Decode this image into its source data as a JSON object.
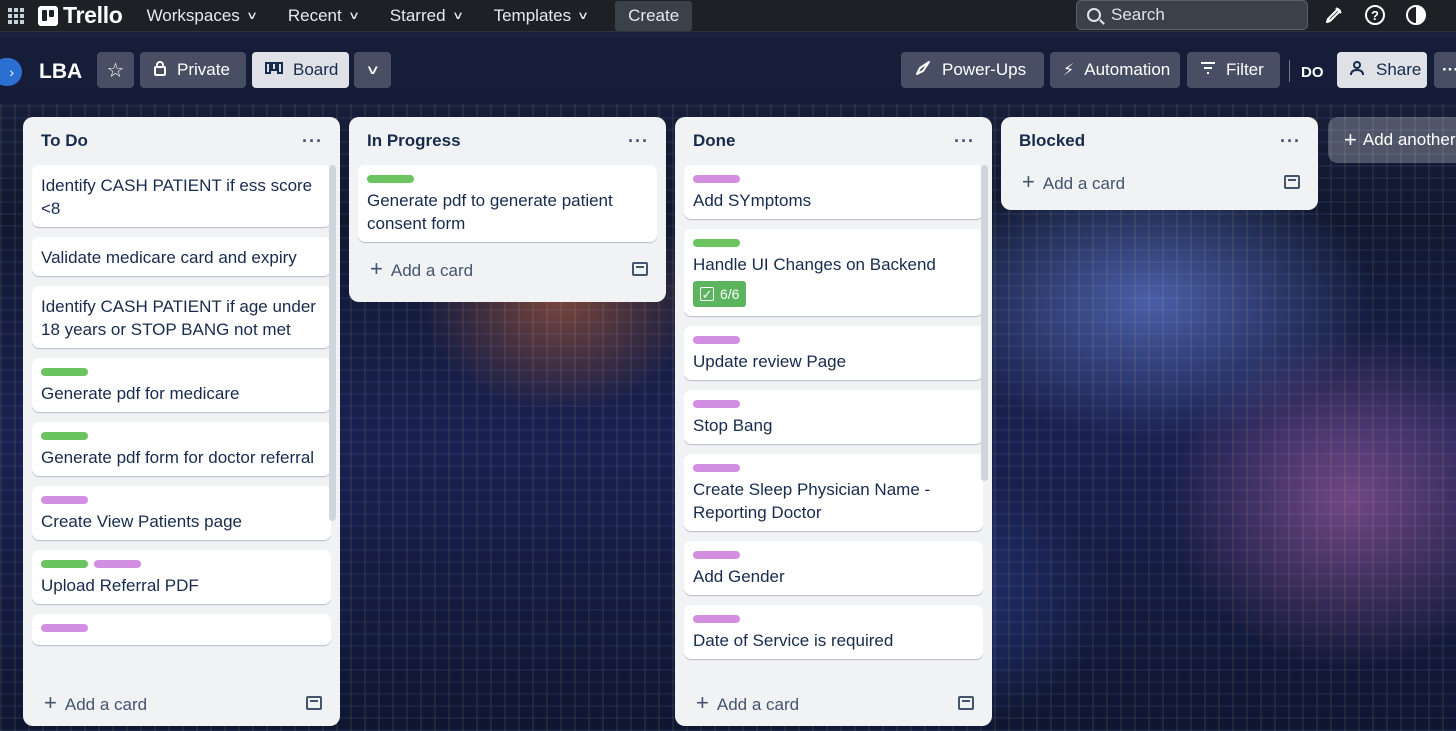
{
  "topnav": {
    "brand": "Trello",
    "items": [
      "Workspaces",
      "Recent",
      "Starred",
      "Templates"
    ],
    "create_label": "Create",
    "search_placeholder": "Search"
  },
  "board": {
    "title": "LBA",
    "private_label": "Private",
    "board_view_label": "Board",
    "powerups_label": "Power-Ups",
    "automation_label": "Automation",
    "filter_label": "Filter",
    "member_initials": "DO",
    "share_label": "Share",
    "add_list_label": "Add another list"
  },
  "colors": {
    "label_green": "#6cc461",
    "label_purple": "#d28fe2",
    "badge_green": "#5bb55e"
  },
  "add_card_label": "Add a card",
  "lists": [
    {
      "title": "To Do",
      "cards": [
        {
          "title": "Identify CASH PATIENT if ess score <8",
          "labels": []
        },
        {
          "title": "Validate medicare card and expiry",
          "labels": []
        },
        {
          "title": "Identify CASH PATIENT if age under 18 years or STOP BANG not met",
          "labels": []
        },
        {
          "title": "Generate pdf for medicare",
          "labels": [
            "green"
          ]
        },
        {
          "title": "Generate pdf form for doctor referral",
          "labels": [
            "green"
          ]
        },
        {
          "title": "Create View Patients page",
          "labels": [
            "purple"
          ]
        },
        {
          "title": "Upload Referral PDF",
          "labels": [
            "green",
            "purple"
          ]
        },
        {
          "title": "",
          "labels": [
            "purple"
          ]
        }
      ]
    },
    {
      "title": "In Progress",
      "cards": [
        {
          "title": "Generate pdf to generate patient consent form",
          "labels": [
            "green"
          ]
        }
      ]
    },
    {
      "title": "Done",
      "cards": [
        {
          "title": "Add SYmptoms",
          "labels": [
            "purple"
          ]
        },
        {
          "title": "Handle UI Changes on Backend",
          "labels": [
            "green"
          ],
          "checklist": "6/6"
        },
        {
          "title": "Update review Page",
          "labels": [
            "purple"
          ]
        },
        {
          "title": "Stop Bang",
          "labels": [
            "purple"
          ]
        },
        {
          "title": "Create Sleep Physician Name - Reporting Doctor",
          "labels": [
            "purple"
          ]
        },
        {
          "title": "Add Gender",
          "labels": [
            "purple"
          ]
        },
        {
          "title": "Date of Service is required",
          "labels": [
            "purple"
          ]
        }
      ]
    },
    {
      "title": "Blocked",
      "cards": []
    }
  ]
}
